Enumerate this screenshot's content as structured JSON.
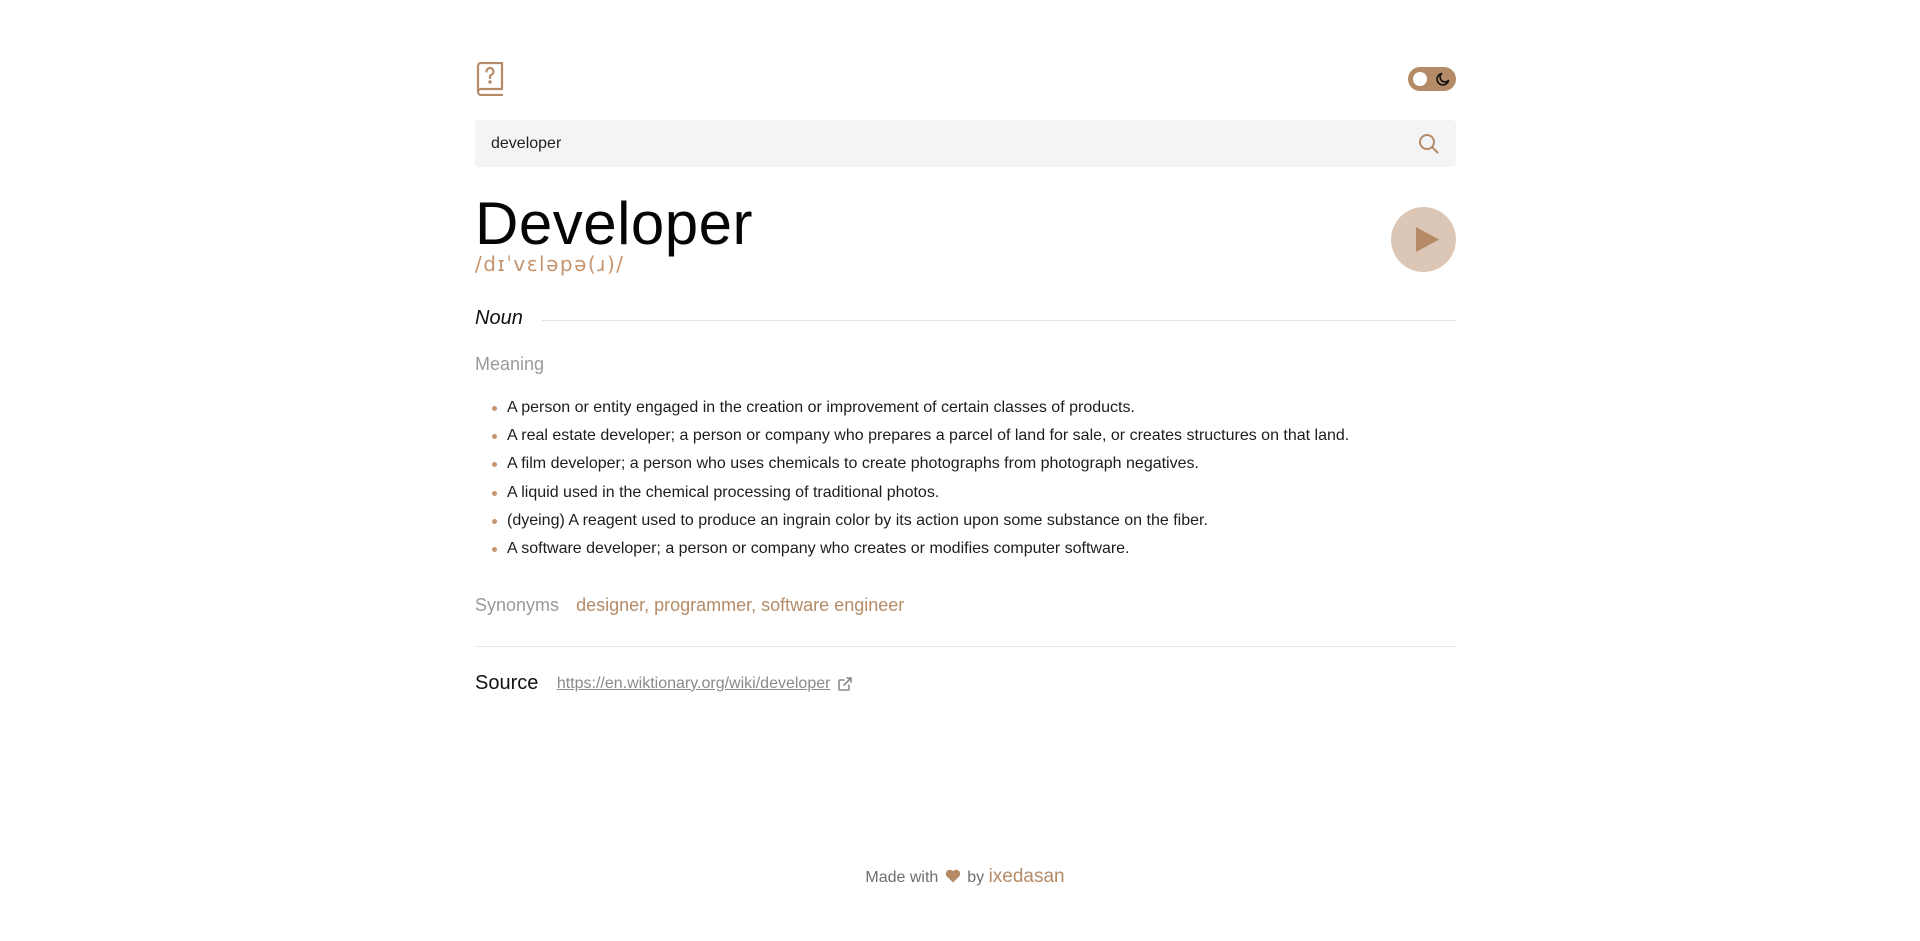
{
  "header": {
    "logo_icon": "book-question-icon",
    "theme_toggle_icon": "moon-icon",
    "accent_color": "#b58b67"
  },
  "search": {
    "value": "developer",
    "icon": "search-icon"
  },
  "entry": {
    "word": "Developer",
    "phonetic": "/dɪˈvɛləpə(ɹ)/",
    "play_icon": "play-icon",
    "part_of_speech": "Noun",
    "meaning_label": "Meaning",
    "definitions": [
      "A person or entity engaged in the creation or improvement of certain classes of products.",
      "A real estate developer; a person or company who prepares a parcel of land for sale, or creates structures on that land.",
      "A film developer; a person who uses chemicals to create photographs from photograph negatives.",
      "A liquid used in the chemical processing of traditional photos.",
      "(dyeing) A reagent used to produce an ingrain color by its action upon some substance on the fiber.",
      "A software developer; a person or company who creates or modifies computer software."
    ],
    "synonyms_label": "Synonyms",
    "synonyms": "designer, programmer, software engineer"
  },
  "source": {
    "label": "Source",
    "url": "https://en.wiktionary.org/wiki/developer",
    "icon": "external-link-icon"
  },
  "footer": {
    "made_with": "Made with",
    "heart_icon": "heart-icon",
    "by": "by",
    "author": "ixedasan"
  }
}
